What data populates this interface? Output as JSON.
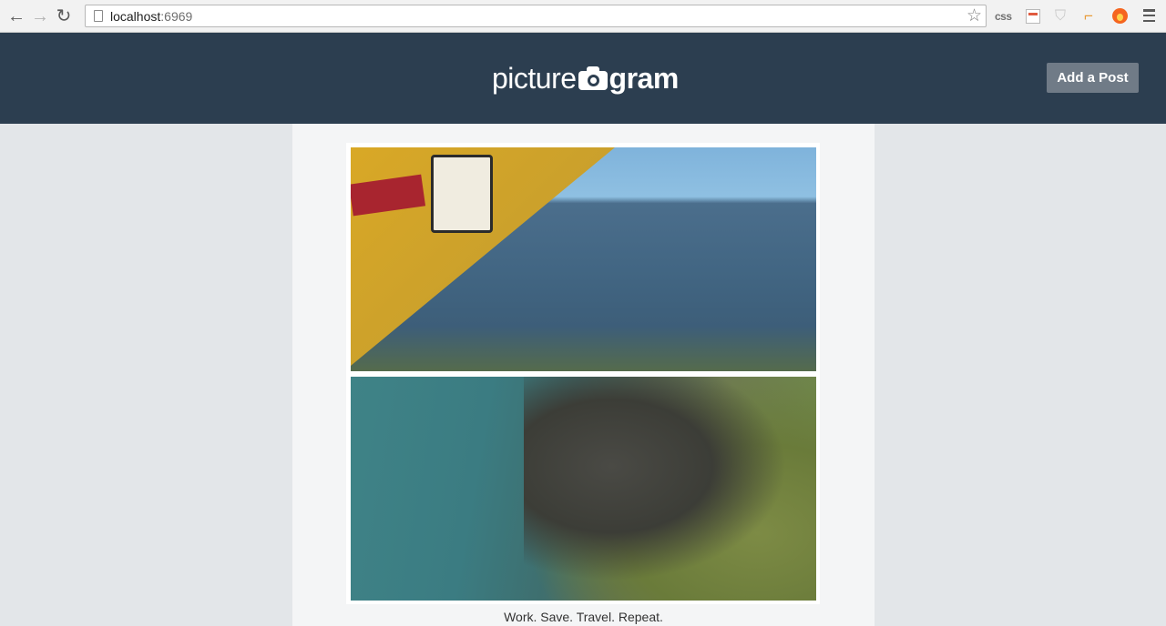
{
  "browser": {
    "url_host": "localhost",
    "url_port": ":6969",
    "extensions": {
      "css_label": "css"
    }
  },
  "header": {
    "logo_left": "picture",
    "logo_right": "gram",
    "add_post_label": "Add a Post",
    "background_color": "#2c3e50"
  },
  "post": {
    "caption": "Work. Save. Travel. Repeat.",
    "photos": [
      {
        "description_icon": "image-sticker-ocean"
      },
      {
        "description_icon": "image-coastal-cliffs"
      }
    ]
  },
  "colors": {
    "header_bg": "#2c3e50",
    "button_bg": "#707b87",
    "page_bg": "#e3e6e9",
    "content_bg": "#f4f5f6"
  }
}
